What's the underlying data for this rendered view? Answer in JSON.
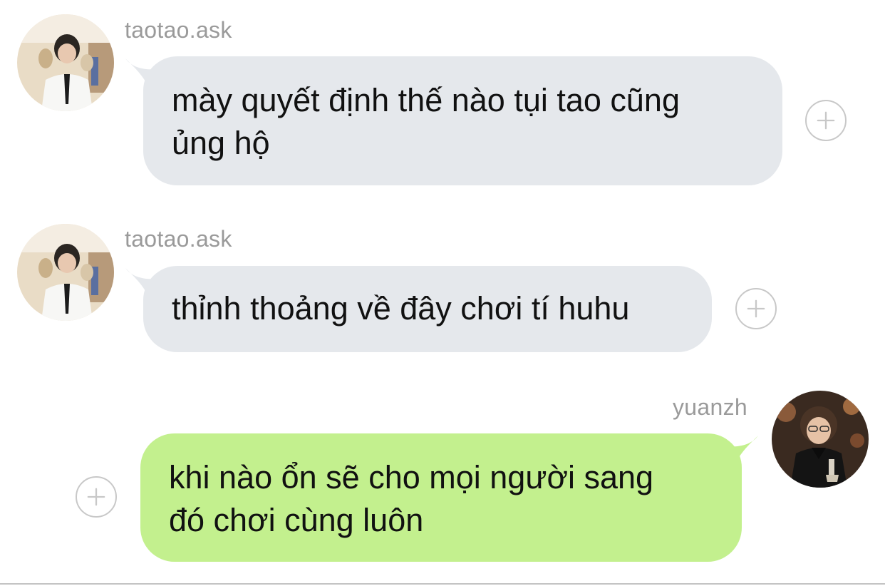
{
  "messages": [
    {
      "sender": "taotao.ask",
      "text_lines": [
        "mày quyết định thế nào tụi tao cũng",
        "ủng hộ"
      ],
      "direction": "incoming"
    },
    {
      "sender": "taotao.ask",
      "text_lines": [
        "thỉnh thoảng về đây chơi tí huhu"
      ],
      "direction": "incoming"
    },
    {
      "sender": "yuanzh",
      "text_lines": [
        "khi nào ổn sẽ cho mọi người sang",
        "đó chơi cùng luôn"
      ],
      "direction": "outgoing"
    }
  ],
  "icons": {
    "add_reaction": "plus-circle-icon",
    "avatar": "user-avatar"
  },
  "colors": {
    "incoming_bubble": "#e5e8ec",
    "outgoing_bubble": "#c3f08e",
    "username": "#9a9a9a",
    "text": "#111111",
    "plus_icon": "#c8c8c8"
  }
}
